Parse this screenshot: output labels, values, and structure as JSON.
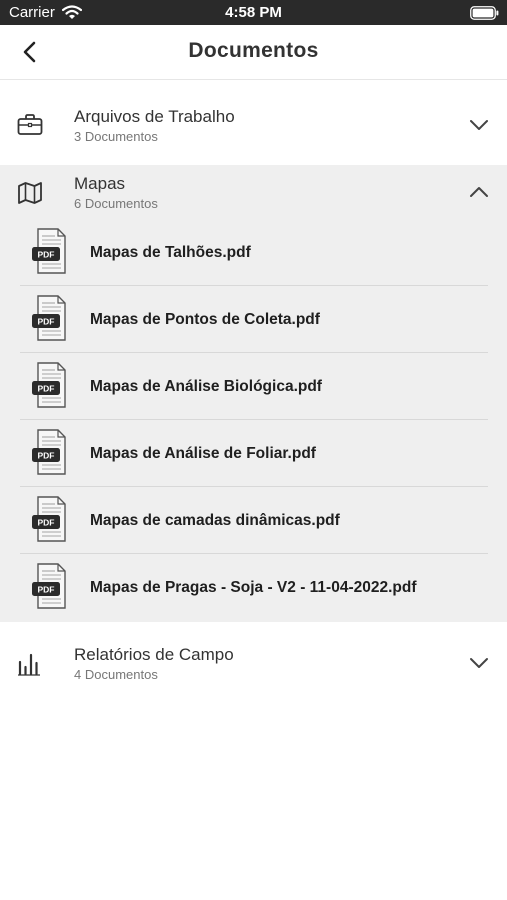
{
  "status_bar": {
    "carrier": "Carrier",
    "time": "4:58 PM"
  },
  "nav": {
    "title": "Documentos"
  },
  "sections": [
    {
      "title": "Arquivos de Trabalho",
      "count": "3 Documentos",
      "icon": "briefcase-icon",
      "expanded": false
    },
    {
      "title": "Mapas",
      "count": "6 Documentos",
      "icon": "map-icon",
      "expanded": true,
      "files": [
        {
          "name": "Mapas de Talhões.pdf",
          "badge": "PDF"
        },
        {
          "name": "Mapas de Pontos de Coleta.pdf",
          "badge": "PDF"
        },
        {
          "name": "Mapas de Análise Biológica.pdf",
          "badge": "PDF"
        },
        {
          "name": "Mapas de Análise de Foliar.pdf",
          "badge": "PDF"
        },
        {
          "name": "Mapas de camadas dinâmicas.pdf",
          "badge": "PDF"
        },
        {
          "name": "Mapas de Pragas - Soja - V2 - 11-04-2022.pdf",
          "badge": "PDF"
        }
      ]
    },
    {
      "title": "Relatórios de Campo",
      "count": "4 Documentos",
      "icon": "bar-chart-icon",
      "expanded": false
    }
  ],
  "colors": {
    "status_bar_bg": "#2a2a2a",
    "expanded_bg": "#efefef",
    "pdf_badge_bg": "#2b2b2b"
  }
}
